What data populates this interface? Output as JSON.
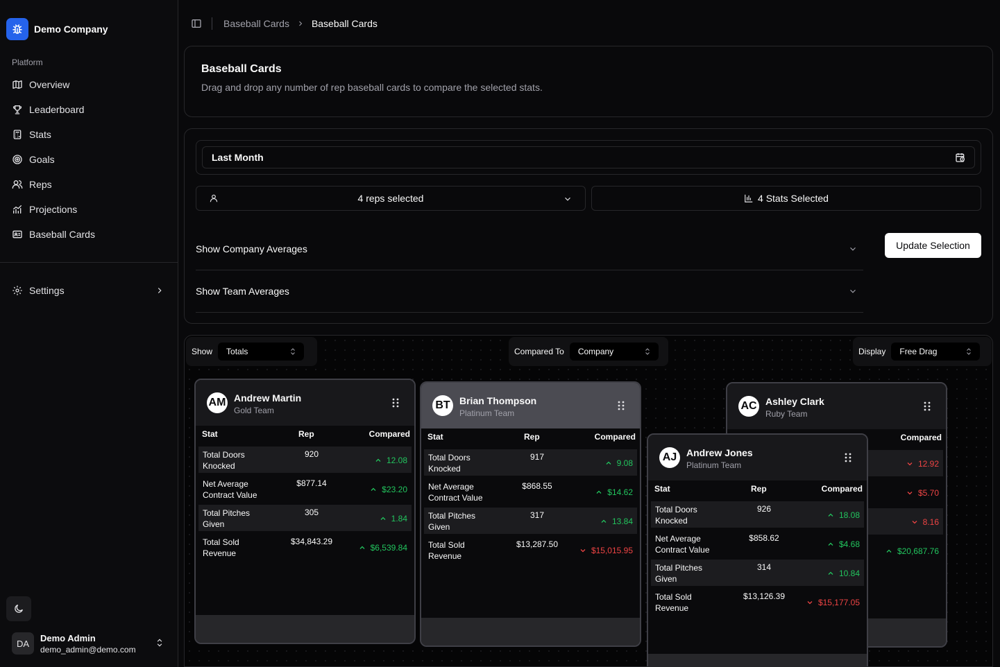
{
  "sidebar": {
    "company": "Demo Company",
    "section": "Platform",
    "items": [
      {
        "label": "Overview",
        "icon": "map-icon"
      },
      {
        "label": "Leaderboard",
        "icon": "trophy-icon"
      },
      {
        "label": "Stats",
        "icon": "calculator-icon"
      },
      {
        "label": "Goals",
        "icon": "target-icon"
      },
      {
        "label": "Reps",
        "icon": "users-icon"
      },
      {
        "label": "Projections",
        "icon": "chart-icon"
      },
      {
        "label": "Baseball Cards",
        "icon": "id-card-icon"
      }
    ],
    "settings": "Settings",
    "user": {
      "initials": "DA",
      "name": "Demo Admin",
      "email": "demo_admin@demo.com"
    }
  },
  "breadcrumb": [
    "Baseball Cards",
    "Baseball Cards"
  ],
  "hero": {
    "title": "Baseball Cards",
    "description": "Drag and drop any number of rep baseball cards to compare the selected stats."
  },
  "filters": {
    "date_range": "Last Month",
    "reps_selected": "4 reps selected",
    "stats_selected": "4 Stats Selected",
    "company_averages": "Show Company Averages",
    "team_averages": "Show Team Averages",
    "update_button": "Update Selection"
  },
  "controls": {
    "show_label": "Show",
    "show_value": "Totals",
    "compared_label": "Compared To",
    "compared_value": "Company",
    "display_label": "Display",
    "display_value": "Free Drag"
  },
  "table_headers": {
    "stat": "Stat",
    "rep": "Rep",
    "compared": "Compared"
  },
  "cards": [
    {
      "initials": "AM",
      "name": "Andrew Martin",
      "team": "Gold Team",
      "rows": [
        {
          "stat": "Total Doors Knocked",
          "rep": "920",
          "compared": "12.08",
          "dir": "up"
        },
        {
          "stat": "Net Average Contract Value",
          "rep": "$877.14",
          "compared": "$23.20",
          "dir": "up"
        },
        {
          "stat": "Total Pitches Given",
          "rep": "305",
          "compared": "1.84",
          "dir": "up"
        },
        {
          "stat": "Total Sold Revenue",
          "rep": "$34,843.29",
          "compared": "$6,539.84",
          "dir": "up"
        }
      ]
    },
    {
      "initials": "BT",
      "name": "Brian Thompson",
      "team": "Platinum Team",
      "rows": [
        {
          "stat": "Total Doors Knocked",
          "rep": "917",
          "compared": "9.08",
          "dir": "up"
        },
        {
          "stat": "Net Average Contract Value",
          "rep": "$868.55",
          "compared": "$14.62",
          "dir": "up"
        },
        {
          "stat": "Total Pitches Given",
          "rep": "317",
          "compared": "13.84",
          "dir": "up"
        },
        {
          "stat": "Total Sold Revenue",
          "rep": "$13,287.50",
          "compared": "$15,015.95",
          "dir": "down"
        }
      ]
    },
    {
      "initials": "AC",
      "name": "Ashley Clark",
      "team": "Ruby Team",
      "rows": [
        {
          "stat": "",
          "rep": "",
          "compared": "12.92",
          "dir": "down"
        },
        {
          "stat": "",
          "rep": "",
          "compared": "$5.70",
          "dir": "down"
        },
        {
          "stat": "",
          "rep": "",
          "compared": "8.16",
          "dir": "down"
        },
        {
          "stat": "",
          "rep": "",
          "compared": "$20,687.76",
          "dir": "up"
        }
      ]
    },
    {
      "initials": "AJ",
      "name": "Andrew Jones",
      "team": "Platinum Team",
      "rows": [
        {
          "stat": "Total Doors Knocked",
          "rep": "926",
          "compared": "18.08",
          "dir": "up"
        },
        {
          "stat": "Net Average Contract Value",
          "rep": "$858.62",
          "compared": "$4.68",
          "dir": "up"
        },
        {
          "stat": "Total Pitches Given",
          "rep": "314",
          "compared": "10.84",
          "dir": "up"
        },
        {
          "stat": "Total Sold Revenue",
          "rep": "$13,126.39",
          "compared": "$15,177.05",
          "dir": "down"
        }
      ]
    }
  ]
}
